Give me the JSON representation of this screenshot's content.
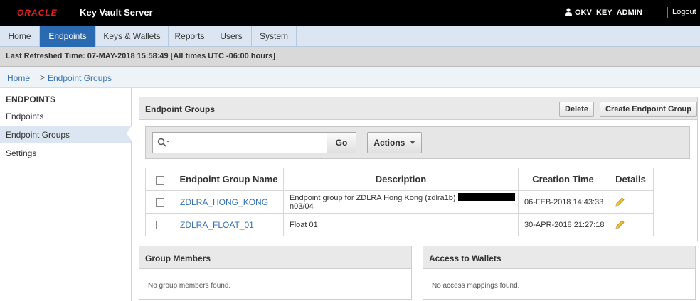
{
  "header": {
    "logo_text": "ORACLE",
    "product_name": "Key Vault Server",
    "username": "OKV_KEY_ADMIN",
    "logout_label": "Logout"
  },
  "nav": {
    "tabs": [
      {
        "label": "Home"
      },
      {
        "label": "Endpoints",
        "active": true
      },
      {
        "label": "Keys & Wallets"
      },
      {
        "label": "Reports"
      },
      {
        "label": "Users"
      },
      {
        "label": "System"
      }
    ]
  },
  "refresh_text": "Last Refreshed Time: 07-MAY-2018 15:58:49 [All times UTC -06:00 hours]",
  "breadcrumb": {
    "home": "Home",
    "separator": ">",
    "current": "Endpoint Groups"
  },
  "sidebar": {
    "heading": "ENDPOINTS",
    "items": [
      {
        "label": "Endpoints"
      },
      {
        "label": "Endpoint Groups",
        "active": true
      },
      {
        "label": "Settings"
      }
    ]
  },
  "endpoint_groups_panel": {
    "title": "Endpoint Groups",
    "delete_label": "Delete",
    "create_label": "Create Endpoint Group",
    "search": {
      "value": "",
      "placeholder": ""
    },
    "go_label": "Go",
    "actions_label": "Actions"
  },
  "table": {
    "columns": [
      "Endpoint Group Name",
      "Description",
      "Creation Time",
      "Details"
    ],
    "rows": [
      {
        "name": "ZDLRA_HONG_KONG",
        "description_prefix": "Endpoint group for ZDLRA Hong Kong (zdlra1b)",
        "description_suffix": "n03/04",
        "created": "06-FEB-2018 14:43:33"
      },
      {
        "name": "ZDLRA_FLOAT_01",
        "description_prefix": "Float 01",
        "description_suffix": "",
        "created": "30-APR-2018 21:27:18"
      }
    ]
  },
  "group_members_panel": {
    "title": "Group Members",
    "empty": "No group members found."
  },
  "access_panel": {
    "title": "Access to Wallets",
    "empty": "No access mappings found."
  },
  "colors": {
    "accent": "#2a6ab0",
    "link": "#3572b0",
    "brand_red": "#e02020"
  },
  "icons": {
    "search": "search-icon",
    "user": "user-icon",
    "edit": "pencil-icon",
    "dropdown": "caret-down-icon"
  }
}
